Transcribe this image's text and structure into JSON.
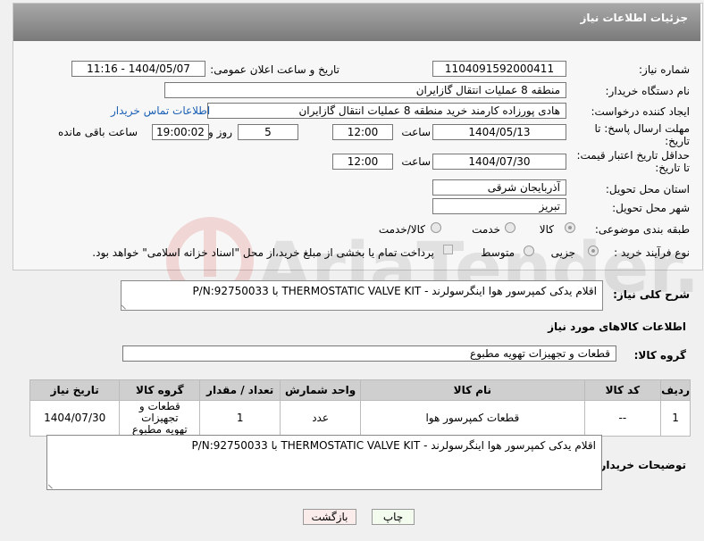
{
  "header": {
    "title": "جزئیات اطلاعات نیاز"
  },
  "form": {
    "need_number": {
      "label": "شماره نیاز:",
      "value": "1104091592000411"
    },
    "announce": {
      "label": "تاریخ و ساعت اعلان عمومی:",
      "value": "1404/05/07 - 11:16"
    },
    "buyer_org": {
      "label": "نام دستگاه خریدار:",
      "value": "منطقه 8 عملیات انتقال گازایران"
    },
    "creator": {
      "label": "ایجاد کننده درخواست:",
      "value": "هادی پورزاده کارمند خرید منطقه 8 عملیات انتقال گازایران",
      "contact_link": "اطلاعات تماس خریدار"
    },
    "reply_deadline": {
      "label_line1": "مهلت ارسال پاسخ: تا",
      "label_line2": "تاریخ:",
      "date": "1404/05/13",
      "time_label": "ساعت",
      "time": "12:00",
      "days": "5",
      "days_label": "روز و",
      "remaining": "19:00:02",
      "remaining_label": "ساعت باقی مانده"
    },
    "price_validity": {
      "label_line1": "حداقل تاریخ اعتبار قیمت:",
      "label_line2": "تا تاریخ:",
      "date": "1404/07/30",
      "time_label": "ساعت",
      "time": "12:00"
    },
    "province": {
      "label": "استان محل تحویل:",
      "value": "آذربایجان شرقی"
    },
    "city": {
      "label": "شهر محل تحویل:",
      "value": "تبریز"
    },
    "category": {
      "label": "طبقه بندی موضوعی:",
      "options": [
        "کالا",
        "خدمت",
        "کالا/خدمت"
      ],
      "selected": "کالا"
    },
    "process": {
      "label": "نوع فرآیند خرید :",
      "options": [
        "جزیی",
        "متوسط"
      ],
      "selected": "جزیی",
      "payment_note": "پرداخت تمام یا بخشی از مبلغ خرید،از محل \"اسناد خزانه اسلامی\" خواهد بود."
    }
  },
  "description": {
    "label": "شرح کلی نیاز:",
    "value": "اقلام یدکی کمپرسور هوا اینگرسولرند - THERMOSTATIC VALVE KIT با P/N:92750033"
  },
  "goods": {
    "section_title": "اطلاعات کالاهای مورد نیاز",
    "group_label": "گروه کالا:",
    "group_value": "قطعات و تجهیزات تهویه مطبوع",
    "columns": [
      "ردیف",
      "کد کالا",
      "نام کالا",
      "واحد شمارش",
      "تعداد / مقدار",
      "گروه کالا",
      "تاریخ نیاز"
    ],
    "rows": [
      {
        "row": "1",
        "code": "--",
        "name": "قطعات کمپرسور هوا",
        "unit": "عدد",
        "qty": "1",
        "group_line1": "قطعات و تجهیزات",
        "group_line2": "تهویه مطبوع",
        "date": "1404/07/30"
      }
    ]
  },
  "buyer_notes": {
    "label": "توضیحات خریدار:",
    "value": "اقلام یدکی کمپرسور هوا اینگرسولرند - THERMOSTATIC VALVE KIT با P/N:92750033"
  },
  "buttons": {
    "print": "چاپ",
    "back": "بازگشت"
  },
  "watermark": {
    "text": "AriaTender.neT"
  }
}
